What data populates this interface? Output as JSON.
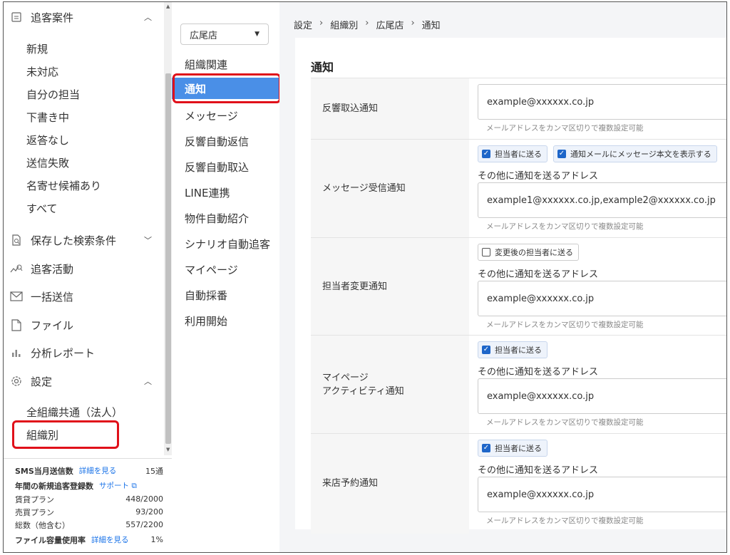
{
  "sidebar": {
    "section_followup": {
      "label": "追客案件",
      "icon": "list-box-icon"
    },
    "followup_items": [
      "新規",
      "未対応",
      "自分の担当",
      "下書き中",
      "返答なし",
      "送信失敗",
      "名寄せ候補あり",
      "すべて"
    ],
    "saved_search": {
      "label": "保存した検索条件",
      "icon": "search-doc-icon"
    },
    "activity": {
      "label": "追客活動",
      "icon": "chart-search-icon"
    },
    "bulk_send": {
      "label": "一括送信",
      "icon": "mail-icon"
    },
    "files": {
      "label": "ファイル",
      "icon": "file-icon"
    },
    "reports": {
      "label": "分析レポート",
      "icon": "bar-chart-icon"
    },
    "settings": {
      "label": "設定",
      "icon": "gear-icon"
    },
    "settings_items": [
      "全組織共通（法人）",
      "組織別"
    ]
  },
  "stats": {
    "sms": {
      "label": "SMS当月送信数",
      "link": "詳細を見る",
      "value": "15通"
    },
    "annual": {
      "label": "年間の新規追客登録数",
      "link": "サポート"
    },
    "rental": {
      "label": "賃貸プラン",
      "value": "448/2000"
    },
    "sales": {
      "label": "売買プラン",
      "value": "93/200"
    },
    "total": {
      "label": "総数（他含む）",
      "value": "557/2200"
    },
    "storage": {
      "label": "ファイル容量使用率",
      "link": "詳細を見る",
      "value": "1%"
    }
  },
  "midnav": {
    "store_select": "広尾店",
    "items": [
      "組織関連",
      "通知",
      "メッセージ",
      "反響自動返信",
      "反響自動取込",
      "LINE連携",
      "物件自動紹介",
      "シナリオ自動追客",
      "マイページ",
      "自動採番",
      "利用開始"
    ]
  },
  "breadcrumb": [
    "設定",
    "組織別",
    "広尾店",
    "通知"
  ],
  "page_title": "通知",
  "common": {
    "hint": "メールアドレスをカンマ区切りで複数設定可能",
    "other_address_label": "その他に通知を送るアドレス"
  },
  "rows": {
    "response": {
      "label": "反響取込通知",
      "email": "example@xxxxxx.co.jp"
    },
    "message": {
      "label": "メッセージ受信通知",
      "chk1": "担当者に送る",
      "chk2": "通知メールにメッセージ本文を表示する",
      "email": "example1@xxxxxx.co.jp,example2@xxxxxx.co.jp"
    },
    "assignee": {
      "label": "担当者変更通知",
      "chk1": "変更後の担当者に送る",
      "email": "example@xxxxxx.co.jp"
    },
    "mypage": {
      "label1": "マイページ",
      "label2": "アクティビティ通知",
      "chk1": "担当者に送る",
      "email": "example@xxxxxx.co.jp"
    },
    "visit": {
      "label": "来店予約通知",
      "chk1": "担当者に送る",
      "email": "example@xxxxxx.co.jp"
    }
  },
  "colors": {
    "accent": "#4a8fe7",
    "highlight": "#e0101a",
    "link": "#1a73e8"
  }
}
